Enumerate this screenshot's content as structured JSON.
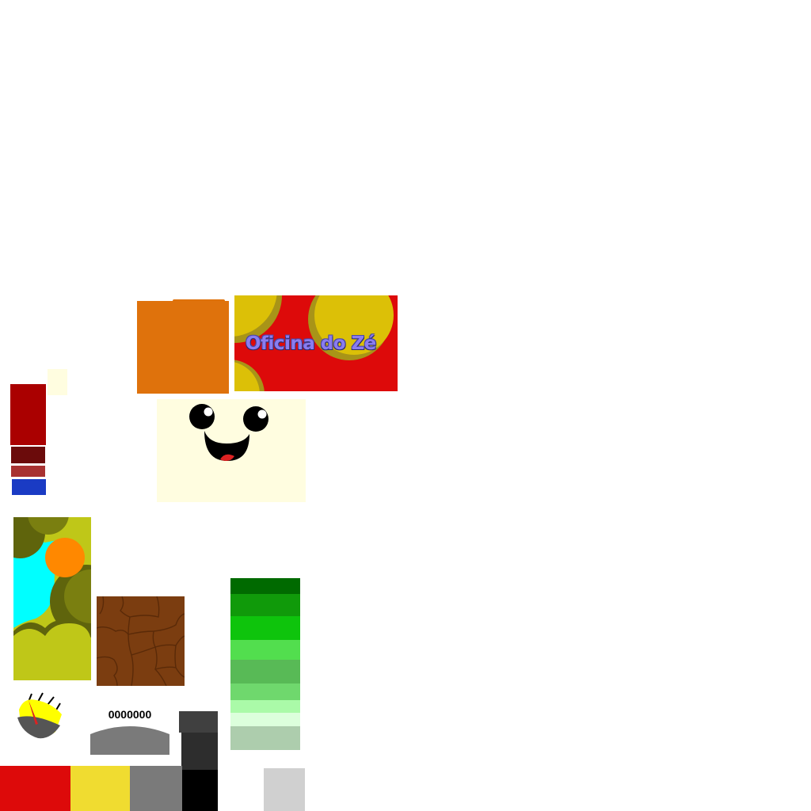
{
  "banner": {
    "title": "Oficina do Zé",
    "title_color": "#8a7cf0",
    "background": "#dd0a0a",
    "circle_color": "#dcc007",
    "circle_shadow": "#a89418"
  },
  "counter": {
    "value": "0000000",
    "arc_color": "#7a7a7a"
  },
  "colors": {
    "red_tall": "#aa0000",
    "dark_red": "#6b0b0b",
    "mid_red": "#a83232",
    "blue": "#1a3bc4",
    "cream": "#fffde0",
    "orange": "#df720c",
    "mud": "#7b3d10",
    "mud_crack": "#5a2a08",
    "sky": "#00ffff",
    "sun": "#ff8800",
    "foliage_light": "#bfc718",
    "foliage_dark": "#5f640c",
    "foliage_mid": "#7a7f10",
    "gauge_yellow": "#ffff00",
    "gauge_dark": "#555555",
    "needle": "#dd2222",
    "tower_cap": "#404040",
    "tower_body": "#2d2d2d",
    "tower_base": "#000000",
    "bar_red": "#dd0a0a",
    "bar_yellow": "#f0dc30",
    "bar_gray": "#7a7a7a",
    "bar_light": "#d0d0d0"
  },
  "greens": [
    "#006a00",
    "#109a0a",
    "#0ec40c",
    "#52de4e",
    "#58ba56",
    "#6fd86d",
    "#aafaa8",
    "#dcffdc",
    "#adcdad"
  ],
  "icons": {
    "face": "smiley-face-icon",
    "gauge": "speed-gauge-icon"
  }
}
